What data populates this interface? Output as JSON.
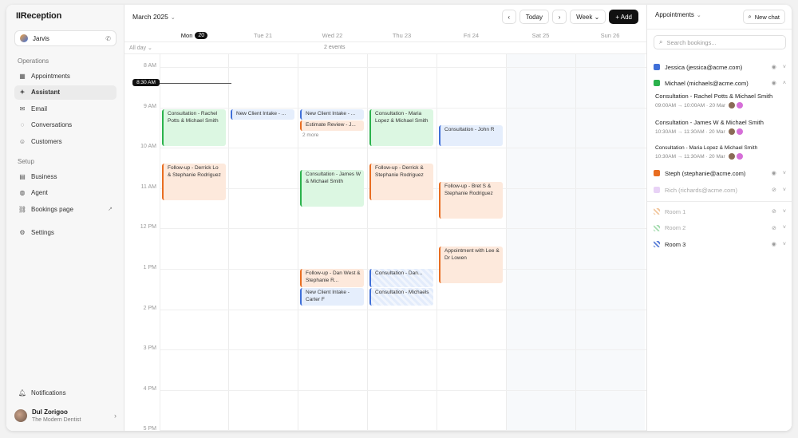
{
  "app": {
    "brand": "IIReception"
  },
  "assistant": {
    "name": "Jarvis"
  },
  "sidebar": {
    "operations_label": "Operations",
    "setup_label": "Setup",
    "operations": [
      {
        "label": "Appointments",
        "icon": "calendar-icon"
      },
      {
        "label": "Assistant",
        "icon": "sparkle-icon",
        "active": true
      },
      {
        "label": "Email",
        "icon": "mail-icon"
      },
      {
        "label": "Conversations",
        "icon": "chat-icon"
      },
      {
        "label": "Customers",
        "icon": "users-icon"
      }
    ],
    "setup": [
      {
        "label": "Business",
        "icon": "building-icon"
      },
      {
        "label": "Agent",
        "icon": "bot-icon"
      },
      {
        "label": "Bookings page",
        "icon": "link-icon"
      }
    ],
    "settings": "Settings",
    "notifications": "Notifications",
    "user": {
      "name": "Dul Zorigoo",
      "org": "The Modern Dentist"
    }
  },
  "calendar": {
    "month": "March 2025",
    "today_btn": "Today",
    "view": "Week",
    "add_btn": "+ Add",
    "days": [
      {
        "label": "Mon",
        "num": "20",
        "today": true
      },
      {
        "label": "Tue 21"
      },
      {
        "label": "Wed 22"
      },
      {
        "label": "Thu 23"
      },
      {
        "label": "Fri 24"
      },
      {
        "label": "Sat 25"
      },
      {
        "label": "Sun 26"
      }
    ],
    "allday_label": "All day",
    "allday_wed": "2 events",
    "hours": [
      "8 AM",
      "9 AM",
      "10 AM",
      "11 AM",
      "12 PM",
      "1 PM",
      "2 PM",
      "3 PM",
      "4 PM",
      "5 PM"
    ],
    "now": "8:30 AM",
    "events": [
      {
        "day": 0,
        "start": 9.05,
        "end": 9.95,
        "color": "green",
        "title": "Consultation - Rachel Potts & Michael Smith"
      },
      {
        "day": 0,
        "start": 10.4,
        "end": 11.3,
        "color": "orange",
        "title": "Follow-up - Derrick Lo & Stephanie Rodriguez"
      },
      {
        "day": 1,
        "start": 9.05,
        "end": 9.3,
        "color": "blue",
        "title": "New Client Intake - ..."
      },
      {
        "day": 2,
        "start": 9.05,
        "end": 9.3,
        "color": "blue",
        "title": "New Client Intake - ..."
      },
      {
        "day": 2,
        "start": 9.33,
        "end": 9.58,
        "color": "orange",
        "title": "Estimate Review - J..."
      },
      {
        "day": 2,
        "start": 10.55,
        "end": 11.45,
        "color": "green",
        "title": "Consultation - James W & Michael Smith"
      },
      {
        "day": 2,
        "start": 13.0,
        "end": 13.45,
        "color": "orange",
        "title": "Follow-up - Dan West & Stephanie R..."
      },
      {
        "day": 2,
        "start": 13.48,
        "end": 13.9,
        "color": "blue",
        "title": "New Client Intake - Carter F"
      },
      {
        "day": 3,
        "start": 9.05,
        "end": 9.95,
        "color": "green",
        "title": "Consultation - Maria Lopez & Michael Smith"
      },
      {
        "day": 3,
        "start": 10.4,
        "end": 11.3,
        "color": "orange",
        "title": "Follow-up - Derrick & Stephanie Rodriguez"
      },
      {
        "day": 3,
        "start": 13.0,
        "end": 13.45,
        "color": "hatch",
        "title": "Consultation - Dan..."
      },
      {
        "day": 3,
        "start": 13.48,
        "end": 13.9,
        "color": "hatch",
        "title": "Consultation - Michaels"
      },
      {
        "day": 4,
        "start": 9.45,
        "end": 9.95,
        "color": "blue",
        "title": "Consultation - John R"
      },
      {
        "day": 4,
        "start": 10.85,
        "end": 11.75,
        "color": "orange",
        "title": "Follow-up - Bret S & Stephanie Rodriguez"
      },
      {
        "day": 4,
        "start": 12.45,
        "end": 13.35,
        "color": "orange",
        "title": "Appointment with Lee & Dr Lowen"
      }
    ],
    "more_wed": "2 more"
  },
  "panel": {
    "title": "Appointments",
    "new_chat": "New chat",
    "search_placeholder": "Search bookings...",
    "calendars": [
      {
        "name": "Jessica (jessica@acme.com)",
        "color": "#3f6fd8",
        "chev": "˅"
      },
      {
        "name": "Michael (michaels@acme.com)",
        "color": "#2bb24c",
        "chev": "˄"
      }
    ],
    "bookings": [
      {
        "title": "Consultation - Rachel Potts & Michael Smith",
        "time": "09:00AM → 10:00AM · 20 Mar"
      },
      {
        "title": "Consultation - James W & Michael Smith",
        "time": "10:30AM → 11:30AM · 20 Mar"
      },
      {
        "title": "Consultation - Maria Lopez & Michael Smith",
        "time": "10:30AM → 11:30AM · 20 Mar"
      }
    ],
    "more_calendars": [
      {
        "name": "Steph (stephanie@acme.com)",
        "color": "#e86d21",
        "muted": false
      },
      {
        "name": "Rich (richards@acme.com)",
        "color": "#d8b4f0",
        "muted": true
      }
    ],
    "rooms": [
      {
        "name": "Room 1",
        "color": "#f2c79e",
        "muted": true
      },
      {
        "name": "Room 2",
        "color": "#a6dcb0",
        "muted": true
      },
      {
        "name": "Room 3",
        "color": "#5b7fd6",
        "muted": false
      }
    ]
  }
}
